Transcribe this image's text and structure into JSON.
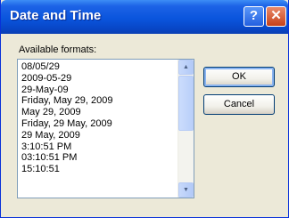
{
  "window": {
    "title": "Date and Time",
    "help_glyph": "?",
    "close_glyph": "✕"
  },
  "formats": {
    "label": "Available formats:",
    "items": [
      "08/05/29",
      "2009-05-29",
      "29-May-09",
      "Friday, May 29, 2009",
      "May 29, 2009",
      "Friday, 29 May, 2009",
      "29 May, 2009",
      "3:10:51 PM",
      "03:10:51 PM",
      "15:10:51"
    ]
  },
  "buttons": {
    "ok": "OK",
    "cancel": "Cancel"
  },
  "scrollbar": {
    "up_glyph": "▲",
    "down_glyph": "▼"
  },
  "colors": {
    "title_bar": "#0a55dd",
    "dialog_bg": "#ece9d8",
    "close_button": "#c6411a"
  }
}
